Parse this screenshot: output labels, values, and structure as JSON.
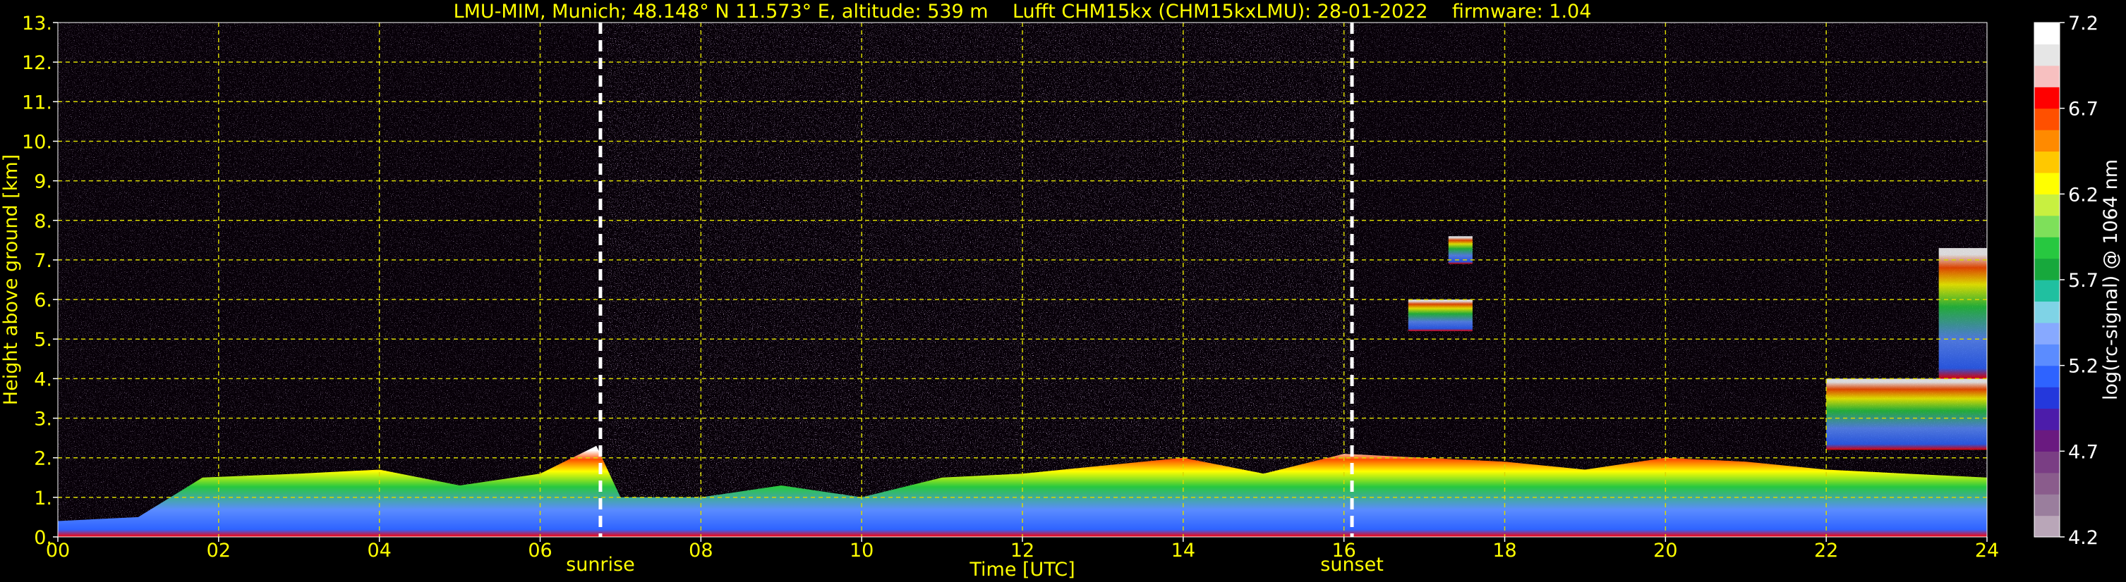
{
  "chart_data": {
    "type": "heatmap",
    "title": "LMU-MIM, Munich; 48.148° N 11.573° E, altitude: 539 m    Lufft CHM15kx (CHM15kxLMU): 28-01-2022    firmware: 1.04",
    "xlabel": "Time [UTC]",
    "ylabel": "Height above ground [km]",
    "x_ticks": [
      "00",
      "02",
      "04",
      "06",
      "08",
      "10",
      "12",
      "14",
      "16",
      "18",
      "20",
      "22",
      "24"
    ],
    "y_ticks": [
      "0.",
      "1.",
      "2.",
      "3.",
      "4.",
      "5.",
      "6.",
      "7.",
      "8.",
      "9.",
      "10.",
      "11.",
      "12.",
      "13."
    ],
    "xlim": [
      0,
      24
    ],
    "ylim": [
      0,
      13
    ],
    "grid": true,
    "markers": [
      {
        "label": "sunrise",
        "time": 6.75
      },
      {
        "label": "sunset",
        "time": 16.1
      }
    ],
    "colorbar": {
      "label": "log(rc-signal) @ 1064 nm",
      "range": [
        4.2,
        7.2
      ],
      "ticks": [
        "4.2",
        "4.7",
        "5.2",
        "5.7",
        "6.2",
        "6.7",
        "7.2"
      ],
      "colors": [
        "#b9a6b8",
        "#9a7e9d",
        "#8a5c8c",
        "#7a3e84",
        "#6a1a80",
        "#4c1caa",
        "#2438dc",
        "#2e63ff",
        "#5b8cff",
        "#87a9ff",
        "#7fd3e6",
        "#20c0a0",
        "#17a83c",
        "#27c840",
        "#7ee05a",
        "#c8f040",
        "#ffff00",
        "#ffc800",
        "#ff8a00",
        "#ff5000",
        "#ff0000",
        "#f7c0c0",
        "#e6e6e6",
        "#ffffff"
      ]
    },
    "cloud_layer_top_km": [
      [
        0,
        0.4
      ],
      [
        1,
        0.5
      ],
      [
        1.8,
        1.5
      ],
      [
        3,
        1.6
      ],
      [
        4,
        1.7
      ],
      [
        5,
        1.3
      ],
      [
        6,
        1.6
      ],
      [
        6.7,
        2.3
      ],
      [
        7,
        1.0
      ],
      [
        8,
        1.0
      ],
      [
        9,
        1.3
      ],
      [
        10,
        1.0
      ],
      [
        11,
        1.5
      ],
      [
        12,
        1.6
      ],
      [
        13,
        1.8
      ],
      [
        14,
        2.0
      ],
      [
        15,
        1.6
      ],
      [
        16,
        2.1
      ],
      [
        17,
        2.0
      ],
      [
        18,
        1.9
      ],
      [
        19,
        1.7
      ],
      [
        20,
        2.0
      ],
      [
        21,
        1.9
      ],
      [
        22,
        1.7
      ],
      [
        23,
        1.6
      ],
      [
        24,
        1.5
      ]
    ],
    "elevated_layers_km": [
      {
        "t0": 16.8,
        "t1": 17.6,
        "h0": 5.2,
        "h1": 6.0
      },
      {
        "t0": 17.3,
        "t1": 17.6,
        "h0": 6.9,
        "h1": 7.6
      },
      {
        "t0": 22.0,
        "t1": 24.0,
        "h0": 2.2,
        "h1": 4.0
      },
      {
        "t0": 23.4,
        "t1": 24.0,
        "h0": 4.0,
        "h1": 7.3
      }
    ]
  }
}
